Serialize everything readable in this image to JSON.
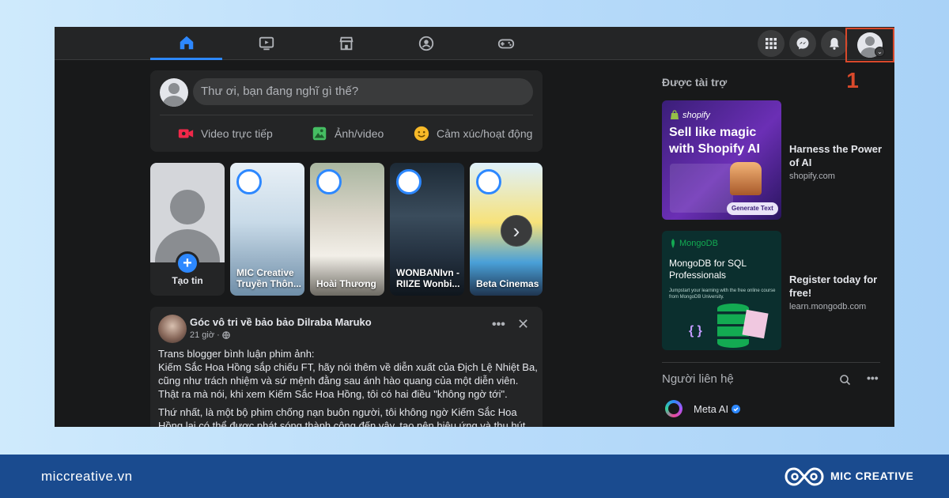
{
  "nav": {
    "tabs": [
      {
        "icon": "home-icon",
        "active": true
      },
      {
        "icon": "video-icon",
        "active": false
      },
      {
        "icon": "marketplace-icon",
        "active": false
      },
      {
        "icon": "groups-icon",
        "active": false
      },
      {
        "icon": "gaming-icon",
        "active": false
      }
    ],
    "right_buttons": [
      "menu-grid-icon",
      "messenger-icon",
      "notifications-icon"
    ],
    "account_avatar": "account-avatar",
    "highlight_color": "#d9492b",
    "step_number": "1"
  },
  "composer": {
    "placeholder": "Thư ơi, bạn đang nghĩ gì thế?",
    "actions": [
      {
        "label": "Video trực tiếp",
        "icon": "live-video-icon",
        "color": "#f02849"
      },
      {
        "label": "Ảnh/video",
        "icon": "photo-icon",
        "color": "#45bd62"
      },
      {
        "label": "Cảm xúc/hoạt động",
        "icon": "feeling-icon",
        "color": "#f7b928"
      }
    ]
  },
  "stories": {
    "create_label": "Tạo tin",
    "items": [
      {
        "name": "MIC Creative Truyền Thôn..."
      },
      {
        "name": "Hoài Thương"
      },
      {
        "name": "WONBANIvn - RIIZE Wonbi..."
      },
      {
        "name": "Beta Cinemas"
      }
    ]
  },
  "post": {
    "author": "Góc vô tri về bảo bảo Dilraba Maruko",
    "time": "21 giờ ·",
    "paragraphs": [
      "Trans blogger bình luận phim ảnh:\nKiếm Sắc Hoa Hồng sắp chiếu FT, hãy nói thêm về diễn xuất của Địch Lệ Nhiệt Ba, cũng như trách nhiệm và sứ mệnh đằng sau ánh hào quang của một diễn viên.\nThật ra mà nói, khi xem Kiếm Sắc Hoa Hồng, tôi có hai điều \"không ngờ tới\".",
      "Thứ nhất, là một bộ phim chống nạn buôn người, tôi không ngờ Kiếm Sắc Hoa Hồng lại có thể được phát sóng thành công đến vậy, tạo nên hiệu ứng và thu hút được"
    ]
  },
  "sidebar": {
    "sponsored_title": "Được tài trợ",
    "ads": [
      {
        "brand": "shopify",
        "headline": "Sell like magic with Shopify AI",
        "button": "Generate Text",
        "title": "Harness the Power of AI",
        "url": "shopify.com"
      },
      {
        "brand": "MongoDB",
        "headline": "MongoDB for SQL Professionals",
        "sub": "Jumpstart your learning with the free online course from MongoDB University.",
        "title": "Register today for free!",
        "url": "learn.mongodb.com"
      }
    ],
    "contacts_title": "Người liên hệ",
    "contacts": [
      {
        "name": "Meta AI",
        "verified": true
      }
    ]
  },
  "footer": {
    "site": "miccreative.vn",
    "brand": "MIC CREATIVE"
  }
}
